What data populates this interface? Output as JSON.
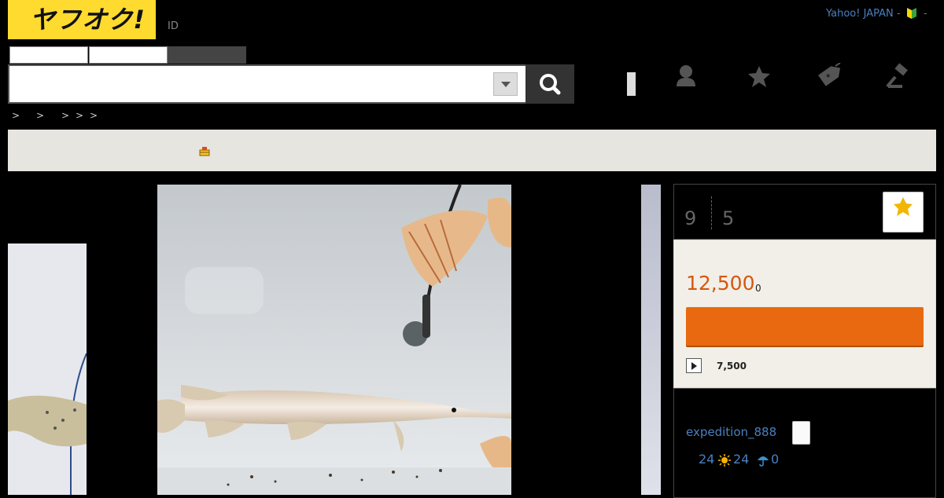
{
  "header": {
    "logo_text": "ヤフオク!",
    "id_label": "ID",
    "yahoo_japan_link": "Yahoo! JAPAN",
    "separator": "-"
  },
  "search": {
    "query": "",
    "placeholder": ""
  },
  "breadcrumb": [
    ">",
    ">",
    ">",
    ">",
    ">"
  ],
  "auction": {
    "watch_count": "9",
    "bid_count": "5",
    "current_price": "12,500",
    "price_suffix": "0",
    "buy_now_price": "7,500"
  },
  "seller": {
    "name": "expedition_888",
    "rating_total": "24",
    "rating_good": "24",
    "rating_bad": "0"
  },
  "colors": {
    "brand_yellow": "#ffdb30",
    "bid_orange": "#e8690f",
    "price_orange": "#d5570e",
    "link_blue": "#4a7fc1"
  },
  "icons": [
    "search-icon",
    "user-icon",
    "star-icon",
    "tag-icon",
    "gavel-icon",
    "beginner-icon",
    "sun-icon",
    "umbrella-icon"
  ]
}
